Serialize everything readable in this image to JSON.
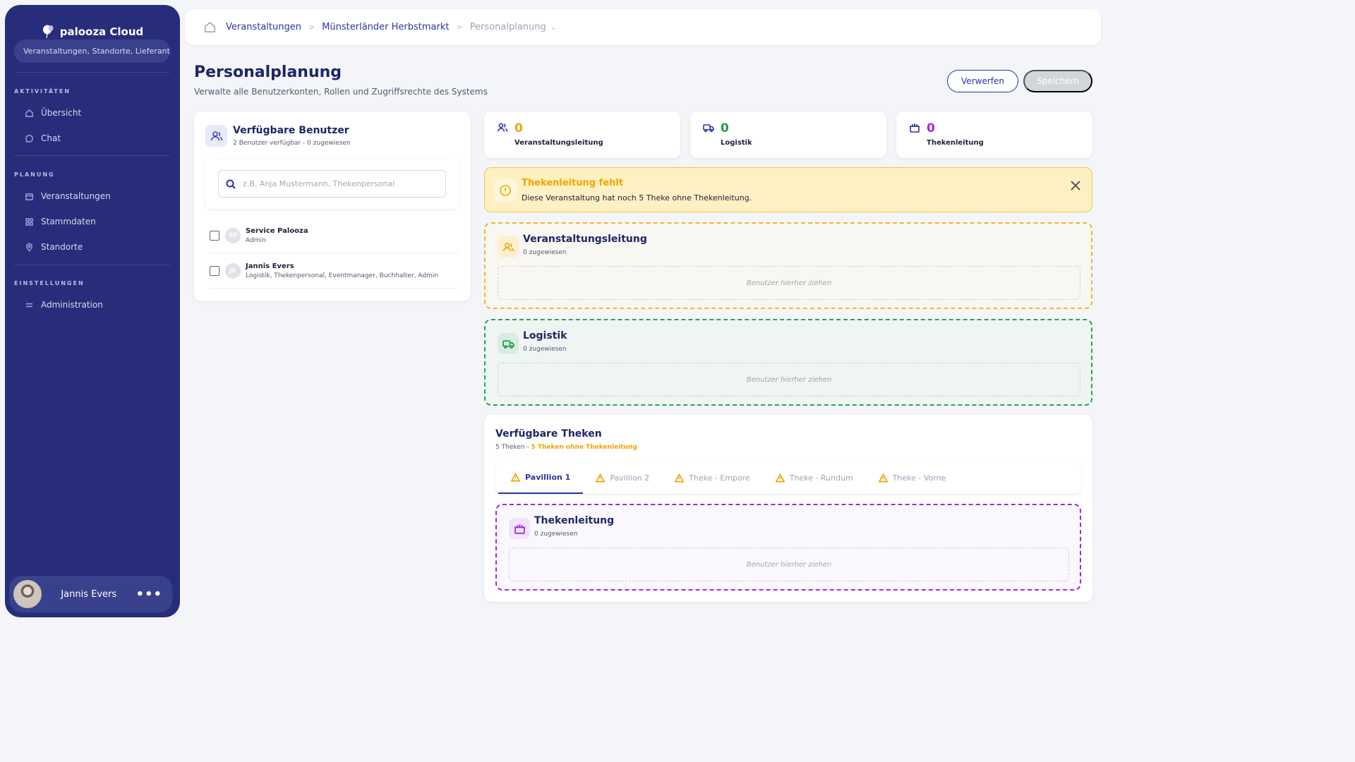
{
  "sidebar": {
    "logo": "palooza Cloud",
    "search_placeholder": "Veranstaltungen, Standorte, Lieferanten",
    "sections": [
      {
        "heading": "AKTIVITÄTEN",
        "items": [
          {
            "label": "Übersicht",
            "icon": "home-icon"
          },
          {
            "label": "Chat",
            "icon": "chat-icon"
          }
        ]
      },
      {
        "heading": "PLANUNG",
        "items": [
          {
            "label": "Veranstaltungen",
            "icon": "calendar-icon"
          },
          {
            "label": "Stammdaten",
            "icon": "grid-icon"
          },
          {
            "label": "Standorte",
            "icon": "location-pin-icon"
          }
        ]
      },
      {
        "heading": "EINSTELLUNGEN",
        "items": [
          {
            "label": "Administration",
            "icon": "sliders-icon"
          }
        ]
      }
    ],
    "user": {
      "name": "Jannis Evers",
      "menu": "•••"
    }
  },
  "breadcrumb": {
    "items": [
      "Veranstaltungen",
      "Münsterländer Herbstmarkt",
      "Personalplanung"
    ]
  },
  "page": {
    "title": "Personalplanung",
    "subtitle": "Verwalte alle Benutzerkonten, Rollen und Zugriffsrechte des Systems",
    "discard_label": "Verwerfen",
    "save_label": "Speichern"
  },
  "users_panel": {
    "title": "Verfügbare Benutzer",
    "subtitle": "2 Benutzer verfügbar - 0 zugewiesen",
    "search_placeholder": "z.B. Anja Mustermann, Thekenpersonal",
    "users": [
      {
        "initials": "SP",
        "name": "Service Palooza",
        "roles": "Admin"
      },
      {
        "initials": "JE",
        "name": "Jannis Evers",
        "roles": "Logistik, Thekenpersonal, Eventmanager, Buchhalter, Admin"
      }
    ]
  },
  "stats": [
    {
      "value": "0",
      "label": "Veranstaltungsleitung",
      "color": "#f0a500"
    },
    {
      "value": "0",
      "label": "Logistik",
      "color": "#1f9d4c"
    },
    {
      "value": "0",
      "label": "Thekenleitung",
      "color": "#a227d9"
    }
  ],
  "alert": {
    "title": "Thekenleitung fehlt",
    "text": "Diese Veranstaltung hat noch 5 Theke ohne Thekenleitung."
  },
  "zones": {
    "veranstaltungsleitung": {
      "title": "Veranstaltungsleitung",
      "sub": "0 zugewiesen",
      "drop": "Benutzer hierher ziehen"
    },
    "logistik": {
      "title": "Logistik",
      "sub": "0 zugewiesen",
      "drop": "Benutzer hierher ziehen"
    }
  },
  "theken": {
    "title": "Verfügbare Theken",
    "sub_count": "5 Theken - ",
    "sub_warning": "5 Theken ohne Thekenleitung",
    "tabs": [
      "Pavillion 1",
      "Pavillion 2",
      "Theke - Empore",
      "Theke - Rundum",
      "Theke - Vorne"
    ],
    "active_tab": "Pavillion 1",
    "zone": {
      "title": "Thekenleitung",
      "sub": "0 zugewiesen",
      "drop": "Benutzer hierher ziehen"
    }
  }
}
